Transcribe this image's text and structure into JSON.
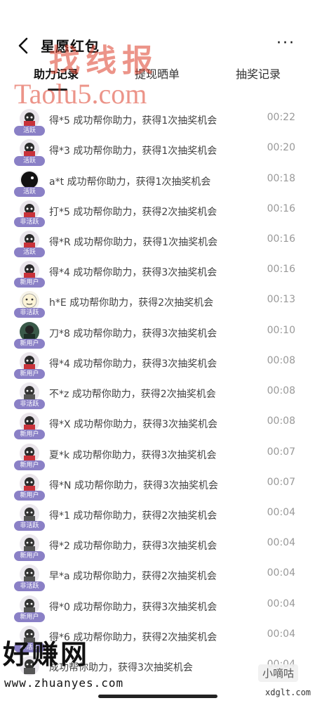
{
  "header": {
    "title": "星愿红包",
    "more_label": "···"
  },
  "tabs": [
    {
      "label": "助力记录",
      "active": true
    },
    {
      "label": "提现晒单",
      "active": false
    },
    {
      "label": "抽奖记录",
      "active": false
    }
  ],
  "records": [
    {
      "badge": "活跃",
      "message": "得*5 成功帮你助力，获得1次抽奖机会",
      "time": "00:22",
      "avatar": "avatar-red",
      "badge_color": "#8a80c6"
    },
    {
      "badge": "活跃",
      "message": "得*3 成功帮你助力，获得1次抽奖机会",
      "time": "00:20",
      "avatar": "avatar-red",
      "badge_color": "#8a80c6"
    },
    {
      "badge": "活跃",
      "message": "a*t 成功帮你助力，获得1次抽奖机会",
      "time": "00:18",
      "avatar": "avatar-black",
      "badge_color": "#8a80c6"
    },
    {
      "badge": "非活跃",
      "message": "打*5 成功帮你助力，获得2次抽奖机会",
      "time": "00:16",
      "avatar": "avatar-red",
      "badge_color": "#8a80c6"
    },
    {
      "badge": "活跃",
      "message": "得*R 成功帮你助力，获得1次抽奖机会",
      "time": "00:16",
      "avatar": "avatar-red",
      "badge_color": "#8a80c6"
    },
    {
      "badge": "新用户",
      "message": "得*4 成功帮你助力，获得3次抽奖机会",
      "time": "00:16",
      "avatar": "avatar-red",
      "badge_color": "#8a80c6"
    },
    {
      "badge": "非活跃",
      "message": "h*E 成功帮你助力，获得2次抽奖机会",
      "time": "00:13",
      "avatar": "avatar-face",
      "badge_color": "#8a80c6"
    },
    {
      "badge": "新用户",
      "message": "刀*8 成功帮你助力，获得3次抽奖机会",
      "time": "00:10",
      "avatar": "avatar-dark",
      "badge_color": "#8a80c6"
    },
    {
      "badge": "新用户",
      "message": "得*4 成功帮你助力，获得3次抽奖机会",
      "time": "00:08",
      "avatar": "avatar-red",
      "badge_color": "#8a80c6"
    },
    {
      "badge": "非活跃",
      "message": "不*z 成功帮你助力，获得2次抽奖机会",
      "time": "00:08",
      "avatar": "avatar-gray",
      "badge_color": "#8a80c6"
    },
    {
      "badge": "新用户",
      "message": "得*X 成功帮你助力，获得3次抽奖机会",
      "time": "00:08",
      "avatar": "avatar-red",
      "badge_color": "#8a80c6"
    },
    {
      "badge": "新用户",
      "message": "夏*k 成功帮你助力，获得3次抽奖机会",
      "time": "00:07",
      "avatar": "avatar-red",
      "badge_color": "#8a80c6"
    },
    {
      "badge": "新用户",
      "message": "得*N 成功帮你助力，获得3次抽奖机会",
      "time": "00:07",
      "avatar": "avatar-red",
      "badge_color": "#8a80c6"
    },
    {
      "badge": "非活跃",
      "message": "得*1 成功帮你助力，获得2次抽奖机会",
      "time": "00:04",
      "avatar": "avatar-gray",
      "badge_color": "#8a80c6"
    },
    {
      "badge": "新用户",
      "message": "得*2 成功帮你助力，获得3次抽奖机会",
      "time": "00:04",
      "avatar": "avatar-gray",
      "badge_color": "#8a80c6"
    },
    {
      "badge": "非活跃",
      "message": "早*a 成功帮你助力，获得2次抽奖机会",
      "time": "00:04",
      "avatar": "avatar-gray",
      "badge_color": "#8a80c6"
    },
    {
      "badge": "新用户",
      "message": "得*0 成功帮你助力，获得3次抽奖机会",
      "time": "00:04",
      "avatar": "avatar-gray",
      "badge_color": "#8a80c6"
    },
    {
      "badge": "非活跃",
      "message": "得*6 成功帮你助力，获得2次抽奖机会",
      "time": "00:04",
      "avatar": "avatar-gray",
      "badge_color": "#8a80c6"
    },
    {
      "badge": "",
      "message": "成功帮你助力，获得3次抽奖机会",
      "time": "00:04",
      "avatar": "avatar-gray",
      "badge_color": "#8a80c6"
    }
  ],
  "watermarks": {
    "top_text": "找线报",
    "top_url": "Taolu5.com",
    "bottom_brand": "好赚网",
    "bottom_url": "www.zhuanyes.com",
    "corner_brand": "小嘀咕",
    "corner_url": "xdglt.com"
  }
}
